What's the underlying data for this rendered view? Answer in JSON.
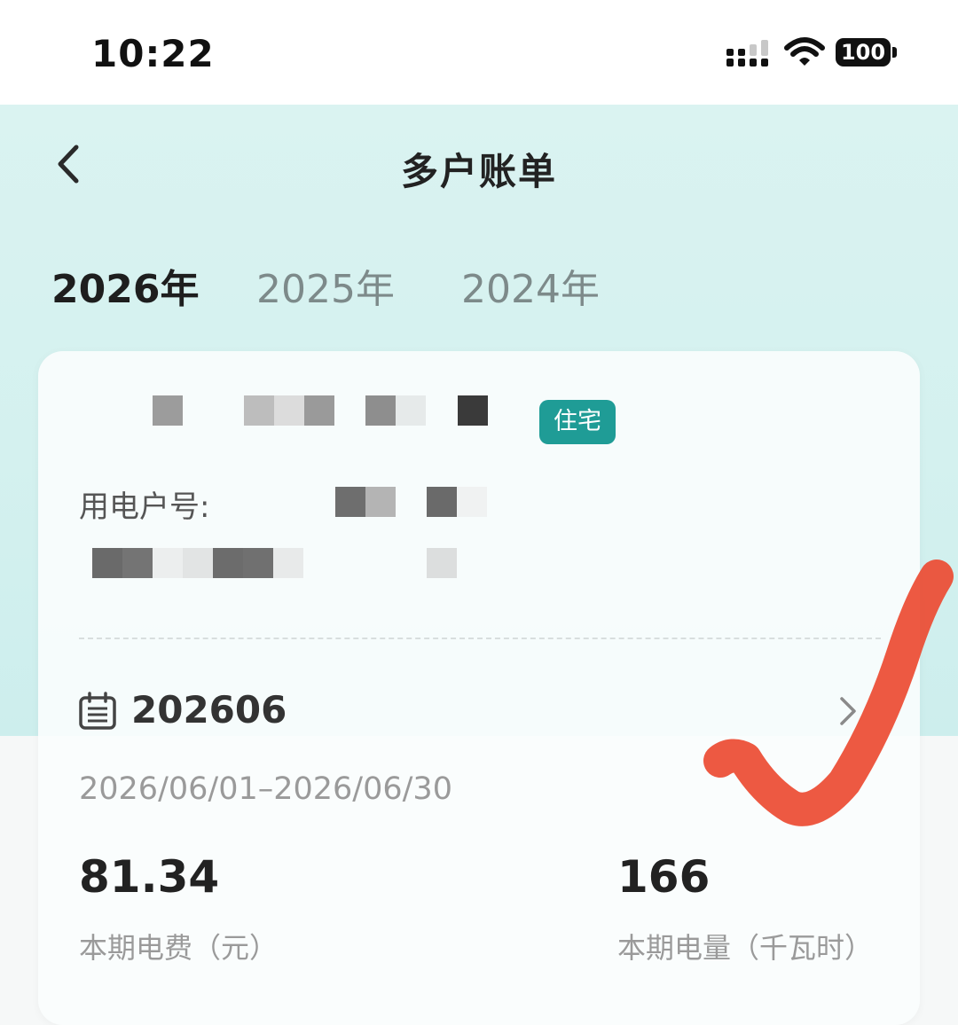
{
  "status_bar": {
    "time": "10:22",
    "battery": "100"
  },
  "header": {
    "title": "多户账单"
  },
  "year_tabs": [
    {
      "label": "2026年",
      "active": true
    },
    {
      "label": "2025年",
      "active": false
    },
    {
      "label": "2024年",
      "active": false
    }
  ],
  "account_card": {
    "type_badge": "住宅",
    "account_label": "用电户号:",
    "bill_period": "202606",
    "date_range": "2026/06/01–2026/06/30",
    "fee_value": "81.34",
    "fee_label": "本期电费（元）",
    "usage_value": "166",
    "usage_label": "本期电量（千瓦时）"
  },
  "colors": {
    "accent": "#1f9c96",
    "hero_bg": "#d4f1ef",
    "handwritten_check": "#ec4b32"
  },
  "icons": [
    "back-chevron-icon",
    "calendar-icon",
    "chevron-right-icon",
    "signal-icon",
    "wifi-icon",
    "battery-icon"
  ]
}
